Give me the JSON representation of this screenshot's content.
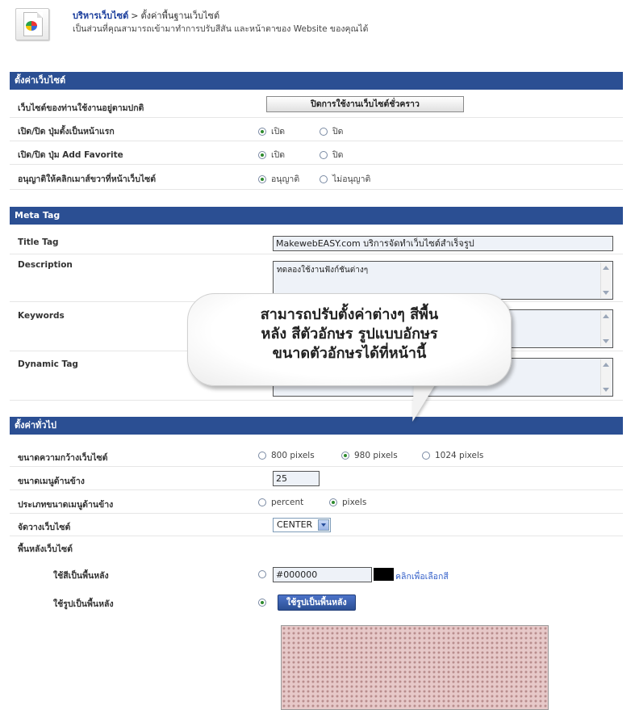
{
  "header": {
    "breadcrumb_link": "บริหารเว็บไซต์",
    "breadcrumb_sep": ">",
    "breadcrumb_current": "ตั้งค่าพื้นฐานเว็บไซต์",
    "subtitle": "เป็นส่วนที่คุณสามารถเข้ามาทำการปรับสีสัน และหน้าตาของ Website ของคุณได้"
  },
  "site_settings": {
    "title": "ตั้งค่าเว็บไซต์",
    "status_label": "เว็บไซต์ของท่านใช้งานอยู่ตามปกติ",
    "close_button": "ปิดการใช้งานเว็บไซต์ชั่วคราว",
    "homepage_btn_label": "เปิด/ปิด ปุ่มตั้งเป็นหน้าแรก",
    "favorite_btn_label": "เปิด/ปิด ปุ่ม Add Favorite",
    "rightclick_label": "อนุญาติให้คลิกเมาส์ขวาที่หน้าเว็บไซต์",
    "on": "เปิด",
    "off": "ปิด",
    "allow": "อนุญาติ",
    "disallow": "ไม่อนุญาติ"
  },
  "meta": {
    "title": "Meta Tag",
    "title_tag_label": "Title Tag",
    "title_tag_value": "MakewebEASY.com บริการจัดทำเว็บไซต์สำเร็จรูป",
    "description_label": "Description",
    "description_value": "ทดลองใช้งานฟังก์ชันต่างๆ",
    "keywords_label": "Keywords",
    "dynamic_label": "Dynamic Tag"
  },
  "callout": {
    "line1": "สามารถปรับตั้งค่าต่างๆ สีพื้น",
    "line2": "หลัง สีตัวอักษร รูปแบบอักษร",
    "line3": "ขนาดตัวอักษรได้ที่หน้านี้"
  },
  "general": {
    "title": "ตั้งค่าทั่วไป",
    "width_label": "ขนาดความกว้างเว็บไซต์",
    "w800": "800 pixels",
    "w980": "980 pixels",
    "w1024": "1024 pixels",
    "side_menu_label": "ขนาดเมนูด้านข้าง",
    "side_menu_value": "25",
    "side_type_label": "ประเภทขนาดเมนูด้านข้าง",
    "percent": "percent",
    "pixels": "pixels",
    "align_label": "จัดวางเว็บไซต์",
    "align_value": "CENTER",
    "bg_label": "พื้นหลังเว็บไซต์",
    "bg_color_label": "ใช้สีเป็นพื้นหลัง",
    "bg_color_value": "#000000",
    "pick_color": "คลิกเพื่อเลือกสี",
    "bg_image_label": "ใช้รูปเป็นพื้นหลัง",
    "bg_image_button": "ใช้รูปเป็นพื้นหลัง"
  },
  "colors": {
    "section_header": "#2b4f93",
    "swatch": "#000000"
  }
}
